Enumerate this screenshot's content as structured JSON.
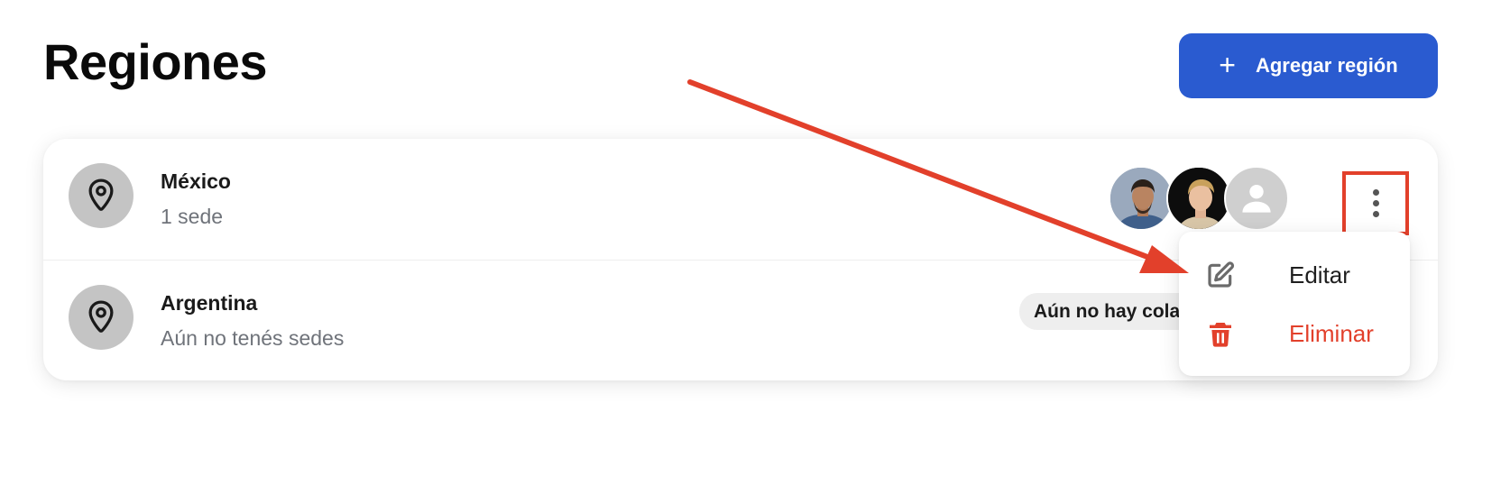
{
  "page": {
    "title": "Regiones",
    "add_button_label": "Agregar región"
  },
  "regions": [
    {
      "name": "México",
      "subtitle": "1 sede",
      "avatars": [
        "avatar-photo-1",
        "avatar-photo-2",
        "avatar-placeholder"
      ]
    },
    {
      "name": "Argentina",
      "subtitle": "Aún no tenés sedes",
      "badge": "Aún no hay colaboradores"
    }
  ],
  "context_menu": {
    "edit_label": "Editar",
    "delete_label": "Eliminar"
  },
  "colors": {
    "primary": "#2a5bd0",
    "danger": "#e2402b",
    "pin_bg": "#c4c4c4",
    "annotation": "#e2402b"
  },
  "icons": {
    "add": "plus-icon",
    "pin": "map-pin-icon",
    "more": "kebab-menu-icon",
    "edit": "edit-icon",
    "delete": "trash-icon",
    "user": "user-placeholder-icon"
  }
}
